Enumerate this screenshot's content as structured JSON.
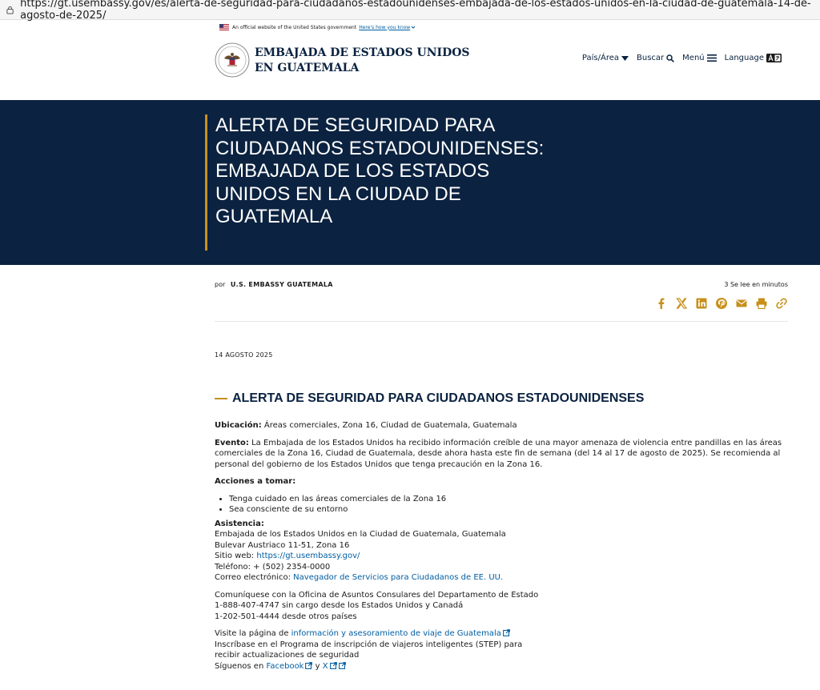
{
  "browser": {
    "url": "https://gt.usembassy.gov/es/alerta-de-seguridad-para-ciudadanos-estadounidenses-embajada-de-los-estados-unidos-en-la-ciudad-de-guatemala-14-de-agosto-de-2025/"
  },
  "gov_banner": {
    "text": "An official website of the United States government",
    "link": "Here's how you know"
  },
  "site": {
    "title_line1": "EMBAJADA DE ESTADOS UNIDOS",
    "title_line2": "EN GUATEMALA",
    "nav": {
      "country": "País/Área",
      "search": "Buscar",
      "menu": "Menú",
      "language": "Language"
    }
  },
  "hero": {
    "title": "ALERTA DE SEGURIDAD PARA CIUDADANOS ESTADOUNIDENSES: EMBAJADA DE LOS ESTADOS UNIDOS EN LA CIUDAD DE GUATEMALA"
  },
  "article": {
    "by": "por",
    "author": "U.S. EMBASSY GUATEMALA",
    "read_time": "3 Se lee en minutos",
    "date": "14 AGOSTO 2025",
    "heading": "ALERTA DE SEGURIDAD PARA CIUDADANOS ESTADOUNIDENSES",
    "location_label": "Ubicación:",
    "location_text": " Áreas comerciales, Zona 16, Ciudad de Guatemala, Guatemala",
    "event_label": "Evento:",
    "event_text": " La Embajada de los Estados Unidos ha recibido información creíble de una mayor amenaza de violencia entre pandillas en las áreas comerciales de la Zona 16, Ciudad de Guatemala, desde ahora hasta este fin de semana (del 14 al 17 de agosto de 2025). Se recomienda al personal del gobierno de los Estados Unidos que tenga precaución en la Zona 16.",
    "actions_label": "Acciones a tomar:",
    "actions": [
      "Tenga cuidado en las áreas comerciales de la Zona 16",
      "Sea consciente de su entorno"
    ],
    "assistance_label": "Asistencia:",
    "assist_line1": "Embajada de los Estados Unidos en la Ciudad de Guatemala, Guatemala",
    "assist_line2": "Bulevar Austriaco 11-51, Zona 16",
    "website_label": "Sitio web: ",
    "website_link": "https://gt.usembassy.gov/",
    "phone": "Teléfono: + (502) 2354-0000",
    "email_label": "Correo electrónico: ",
    "email_link": "Navegador de Servicios para Ciudadanos de EE. UU.",
    "consular_line1": "Comuníquese con la Oficina de Asuntos Consulares del Departamento de Estado",
    "consular_line2": "1-888-407-4747 sin cargo desde los Estados Unidos y Canadá",
    "consular_line3": "1-202-501-4444 desde otros países",
    "visit_prefix": "Visite la página de ",
    "visit_link": "información y asesoramiento de viaje de Guatemala",
    "step_line1": "Inscríbase en el Programa de inscripción de viajeros inteligentes (STEP) para",
    "step_line2": "recibir actualizaciones de seguridad",
    "follow_prefix": "Síguenos en ",
    "facebook": "Facebook",
    "and": " y ",
    "x": "X"
  },
  "colors": {
    "navy": "#0b2240",
    "gold": "#c7901c",
    "link": "#005ea2"
  },
  "icons": [
    "lock-icon",
    "us-flag-icon",
    "embassy-seal-icon",
    "caret-down-icon",
    "search-icon",
    "hamburger-icon",
    "language-icon",
    "facebook-icon",
    "x-icon",
    "linkedin-icon",
    "pinterest-icon",
    "email-icon",
    "print-icon",
    "link-icon",
    "external-link-icon"
  ]
}
